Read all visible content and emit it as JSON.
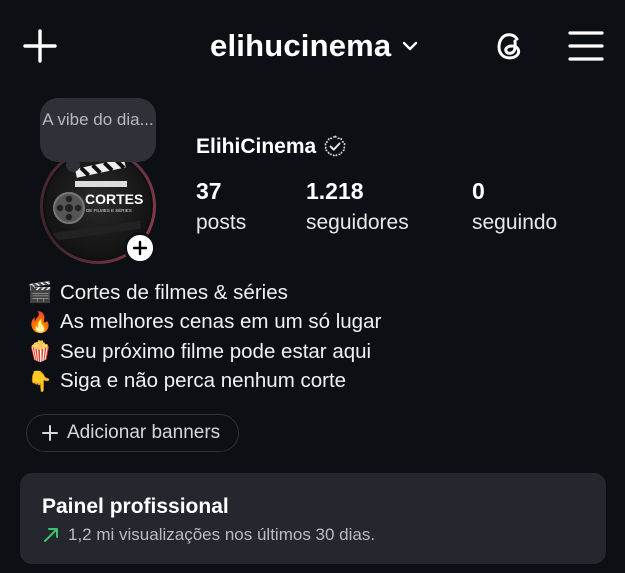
{
  "header": {
    "username": "elihucinema"
  },
  "note": {
    "text": "A vibe do dia..."
  },
  "profile": {
    "display_name": "ElihiCinema",
    "avatar_text": "CORTES",
    "avatar_subtext": "DE FILMES E SÉRIES"
  },
  "stats": [
    {
      "value": "37",
      "label": "posts"
    },
    {
      "value": "1.218",
      "label": "seguidores"
    },
    {
      "value": "0",
      "label": "seguindo"
    }
  ],
  "bio": [
    {
      "emoji": "🎬",
      "text": "Cortes de filmes & séries"
    },
    {
      "emoji": "🔥",
      "text": "As melhores cenas em um só lugar"
    },
    {
      "emoji": "🍿",
      "text": "Seu próximo filme pode estar aqui"
    },
    {
      "emoji": "👇",
      "text": "Siga e não perca nenhum corte"
    }
  ],
  "banner_button": {
    "label": "Adicionar banners"
  },
  "panel": {
    "title": "Painel profissional",
    "subtitle": "1,2 mi visualizações nos últimos 30 dias."
  },
  "colors": {
    "background": "#0c0f14",
    "panel": "#24282e",
    "note": "#2e3238",
    "trend_green": "#3cc46a"
  }
}
